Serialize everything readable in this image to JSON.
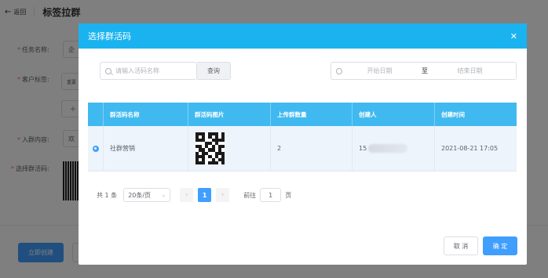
{
  "background": {
    "back_label": "返回",
    "page_title": "标签拉群",
    "form": {
      "task_name_label": "任务名称:",
      "task_name_value": "企",
      "customer_tag_label": "客户标签:",
      "tag_chip": "重要",
      "add_symbol": "+",
      "join_content_label": "入群内容:",
      "join_content_value": "欢",
      "select_code_label": "选择群活码:"
    },
    "create_button": "立即创建"
  },
  "dialog": {
    "title": "选择群活码",
    "close_icon": "close-icon",
    "search": {
      "placeholder": "请输入活码名称",
      "query_button": "查询"
    },
    "date_range": {
      "start_placeholder": "开始日期",
      "separator": "至",
      "end_placeholder": "结束日期"
    },
    "table": {
      "headers": [
        "群活码名称",
        "群活码图片",
        "上传群数量",
        "创建人",
        "创建时间"
      ],
      "rows": [
        {
          "name": "社群营销",
          "count": "2",
          "creator_prefix": "15",
          "created_at": "2021-08-21 17:05"
        }
      ]
    },
    "pagination": {
      "total": "共 1 条",
      "page_size": "20条/页",
      "prev": "‹",
      "current_page": "1",
      "next": "›",
      "goto_label": "前往",
      "goto_value": "1",
      "page_suffix": "页"
    },
    "cancel_button": "取 消",
    "ok_button": "确 定"
  }
}
